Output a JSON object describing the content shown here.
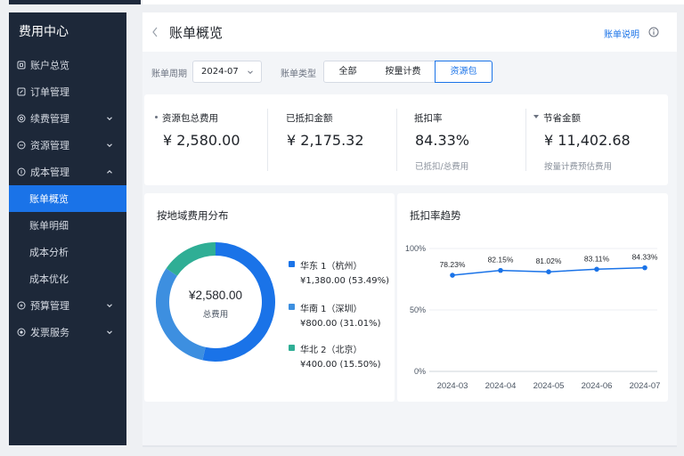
{
  "sidebar": {
    "title": "费用中心",
    "items": [
      {
        "label": "账户总览",
        "icon": "account-icon"
      },
      {
        "label": "订单管理",
        "icon": "order-icon"
      },
      {
        "label": "续费管理",
        "icon": "renew-icon"
      },
      {
        "label": "资源管理",
        "icon": "resource-icon"
      },
      {
        "label": "成本管理",
        "icon": "cost-icon"
      },
      {
        "label": "预算管理",
        "icon": "budget-icon"
      },
      {
        "label": "发票服务",
        "icon": "invoice-icon"
      }
    ],
    "cost_sub": [
      "账单概览",
      "账单明细",
      "成本分析",
      "成本优化"
    ],
    "active_sub": "账单概览"
  },
  "header": {
    "title": "账单概览",
    "help_link": "账单说明"
  },
  "filters": {
    "period_label": "账单周期",
    "period_value": "2024-07",
    "type_label": "账单类型",
    "type_options": [
      "全部",
      "按量计费",
      "资源包"
    ],
    "type_selected": "资源包"
  },
  "stats": [
    {
      "label": "资源包总费用",
      "value": "¥ 2,580.00",
      "sub": ""
    },
    {
      "label": "已抵扣金额",
      "value": "¥ 2,175.32",
      "sub": ""
    },
    {
      "label": "抵扣率",
      "value": "84.33%",
      "sub": "已抵扣/总费用"
    },
    {
      "label": "节省金额",
      "value": "¥ 11,402.68",
      "sub": "按量计费预估费用"
    }
  ],
  "region_card": {
    "title": "按地域费用分布",
    "center_value": "¥2,580.00",
    "center_label": "总费用",
    "legend": [
      {
        "name": "华东 1（杭州）",
        "amount": "¥1,380.00 (53.49%)",
        "color": "#1a73e8"
      },
      {
        "name": "华南 1（深圳）",
        "amount": "¥800.00 (31.01%)",
        "color": "#3d8fe0"
      },
      {
        "name": "华北 2（北京）",
        "amount": "¥400.00 (15.50%)",
        "color": "#2fae95"
      }
    ]
  },
  "trend_card": {
    "title": "抵扣率趋势"
  },
  "chart_data": [
    {
      "type": "pie",
      "categories": [
        "华东 1（杭州）",
        "华南 1（深圳）",
        "华北 2（北京）"
      ],
      "values": [
        1380.0,
        800.0,
        400.0
      ],
      "percent": [
        53.49,
        31.01,
        15.5
      ],
      "colors": [
        "#1a73e8",
        "#3d8fe0",
        "#2fae95"
      ]
    },
    {
      "type": "line",
      "x": [
        "2024-03",
        "2024-04",
        "2024-05",
        "2024-06",
        "2024-07"
      ],
      "values": [
        78.23,
        82.15,
        81.02,
        83.11,
        84.33
      ],
      "data_labels": [
        "78.23%",
        "82.15%",
        "81.02%",
        "83.11%",
        "84.33%"
      ],
      "y_ticks": [
        "100%",
        "50%",
        "0%"
      ],
      "ylim": [
        0,
        100
      ],
      "color": "#1a73e8",
      "grid": true
    }
  ]
}
